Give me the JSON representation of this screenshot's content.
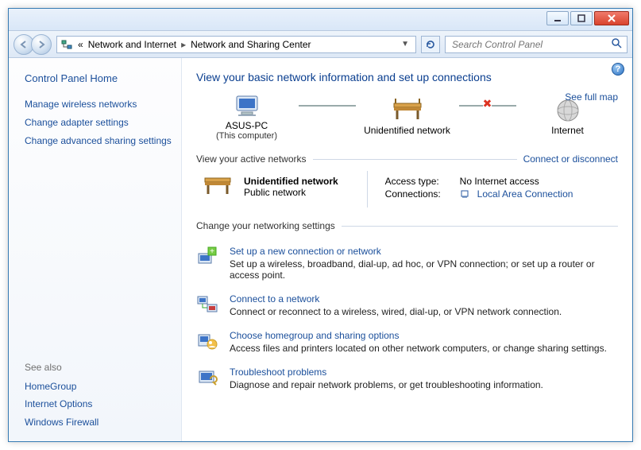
{
  "window": {
    "min_tip": "Minimize",
    "max_tip": "Maximize",
    "close_tip": "Close"
  },
  "breadcrumb": {
    "level1_prefix": "«",
    "level1": "Network and Internet",
    "level2": "Network and Sharing Center"
  },
  "search": {
    "placeholder": "Search Control Panel"
  },
  "sidebar": {
    "home": "Control Panel Home",
    "links": [
      "Manage wireless networks",
      "Change adapter settings",
      "Change advanced sharing settings"
    ],
    "see_also_label": "See also",
    "see_also": [
      "HomeGroup",
      "Internet Options",
      "Windows Firewall"
    ]
  },
  "main": {
    "title": "View your basic network information and set up connections",
    "map": {
      "full_map": "See full map",
      "node1": "ASUS-PC",
      "node1_sub": "(This computer)",
      "node2": "Unidentified network",
      "node3": "Internet"
    },
    "active_header": "View your active networks",
    "connect_link": "Connect or disconnect",
    "active": {
      "name": "Unidentified network",
      "type": "Public network",
      "access_label": "Access type:",
      "access_value": "No Internet access",
      "conn_label": "Connections:",
      "conn_value": "Local Area Connection"
    },
    "change_header": "Change your networking settings",
    "settings": [
      {
        "title": "Set up a new connection or network",
        "desc": "Set up a wireless, broadband, dial-up, ad hoc, or VPN connection; or set up a router or access point."
      },
      {
        "title": "Connect to a network",
        "desc": "Connect or reconnect to a wireless, wired, dial-up, or VPN network connection."
      },
      {
        "title": "Choose homegroup and sharing options",
        "desc": "Access files and printers located on other network computers, or change sharing settings."
      },
      {
        "title": "Troubleshoot problems",
        "desc": "Diagnose and repair network problems, or get troubleshooting information."
      }
    ]
  }
}
